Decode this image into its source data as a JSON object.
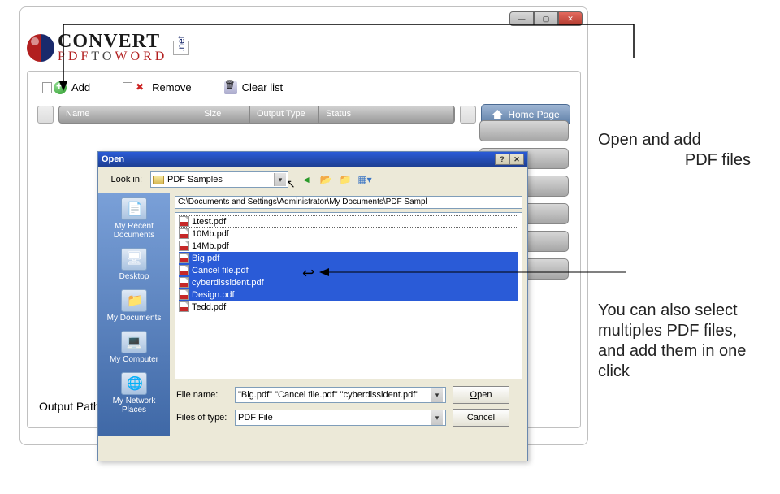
{
  "app": {
    "logo_line1": "CONVERT",
    "logo_line2_red": "PDF",
    "logo_line2_mid": "TO",
    "logo_line2_end": "WORD",
    "logo_net": ".net"
  },
  "toolbar": {
    "add": "Add",
    "remove": "Remove",
    "clear": "Clear list"
  },
  "columns": {
    "name": "Name",
    "size": "Size",
    "output": "Output Type",
    "status": "Status"
  },
  "buttons": {
    "home": "Home Page"
  },
  "output_path_label": "Output Path :",
  "open_dialog": {
    "title": "Open",
    "lookin_label": "Look in:",
    "lookin_value": "PDF Samples",
    "path_tooltip": "C:\\Documents and Settings\\Administrator\\My Documents\\PDF Sampl",
    "places": {
      "recent": "My Recent Documents",
      "desktop": "Desktop",
      "mydocs": "My Documents",
      "mycomputer": "My Computer",
      "network": "My Network Places"
    },
    "files": [
      {
        "name": "1test.pdf",
        "selected": false,
        "focus": true
      },
      {
        "name": "10Mb.pdf",
        "selected": false
      },
      {
        "name": "14Mb.pdf",
        "selected": false
      },
      {
        "name": "Big.pdf",
        "selected": true
      },
      {
        "name": "Cancel file.pdf",
        "selected": true
      },
      {
        "name": "cyberdissident.pdf",
        "selected": true
      },
      {
        "name": "Design.pdf",
        "selected": true
      },
      {
        "name": "Tedd.pdf",
        "selected": false
      }
    ],
    "filename_label": "File name:",
    "filename_value": "\"Big.pdf\" \"Cancel file.pdf\" \"cyberdissident.pdf\"",
    "filetype_label": "Files of type:",
    "filetype_value": "PDF File",
    "open_btn": "Open",
    "cancel_btn": "Cancel"
  },
  "annotations": {
    "a1_l1": "Open and add",
    "a1_l2": "PDF files",
    "a2": "You can also select multiples PDF files, and add them in one click"
  }
}
